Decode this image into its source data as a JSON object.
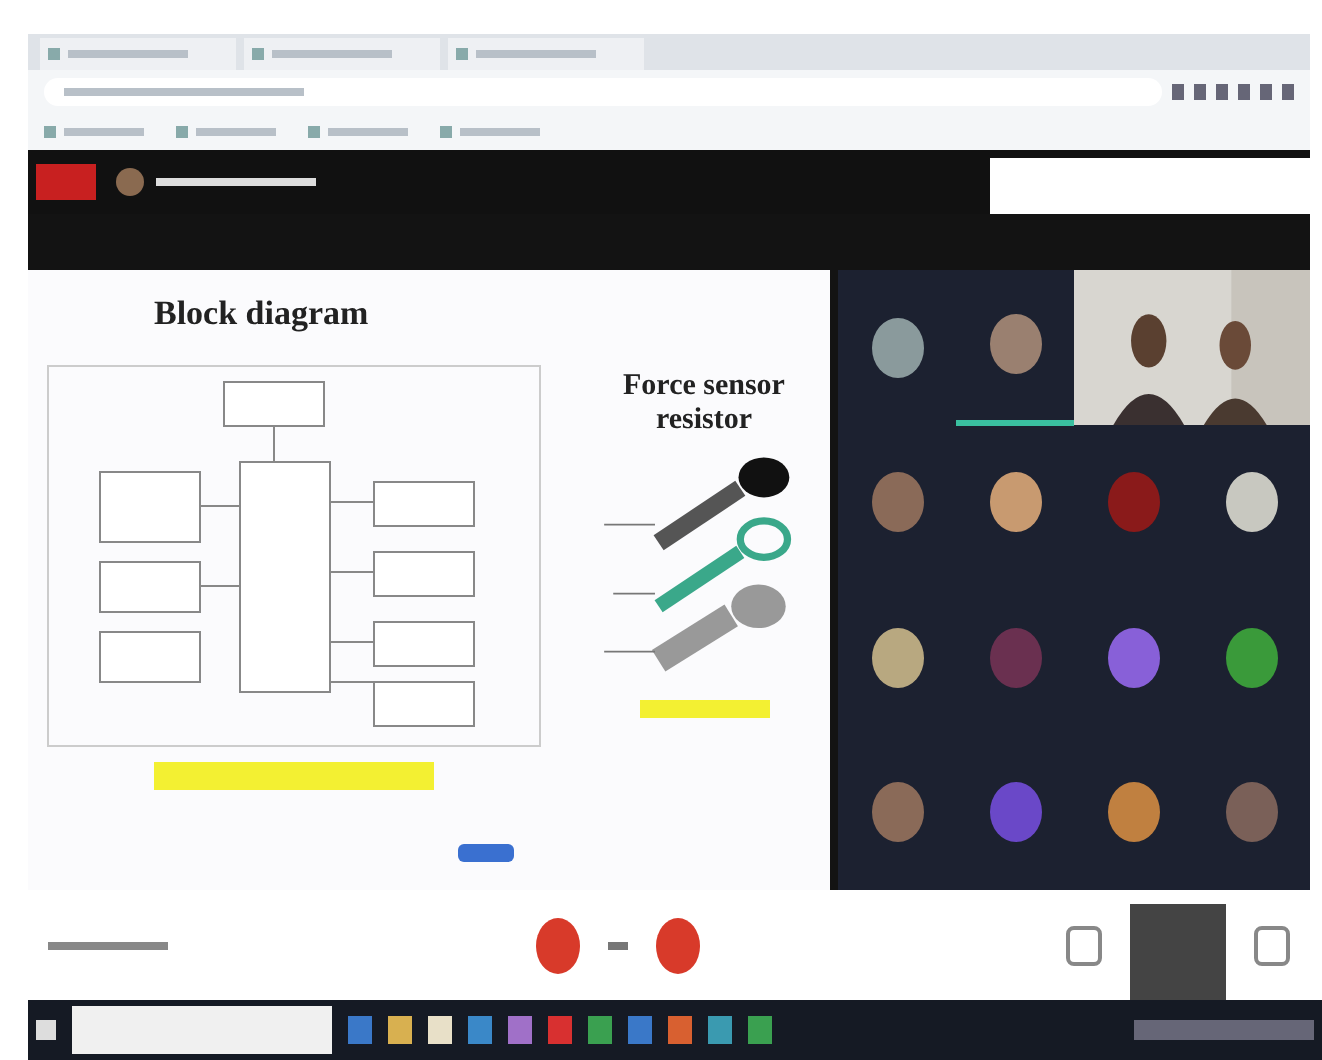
{
  "slide": {
    "title": "Block diagram",
    "side_title": "Force sensor resistor"
  },
  "participants": [
    {
      "kind": "avatar",
      "color": "#8a9a9c"
    },
    {
      "kind": "avatar",
      "color": "#9a8070",
      "speaking": true
    },
    {
      "kind": "video"
    },
    {
      "kind": "avatar",
      "color": "#8a6a58"
    },
    {
      "kind": "avatar",
      "color": "#c89a70"
    },
    {
      "kind": "avatar",
      "color": "#8a1a1a"
    },
    {
      "kind": "avatar",
      "color": "#c8c8c0"
    },
    {
      "kind": "avatar",
      "color": "#b8a880"
    },
    {
      "kind": "avatar",
      "color": "#6a3050"
    },
    {
      "kind": "avatar",
      "color": "#8860d8"
    },
    {
      "kind": "avatar",
      "color": "#3a9a3a"
    },
    {
      "kind": "avatar",
      "color": "#8a6a58"
    },
    {
      "kind": "avatar",
      "color": "#6a48c8"
    },
    {
      "kind": "avatar",
      "color": "#c08040"
    },
    {
      "kind": "avatar",
      "color": "#7a6058"
    }
  ]
}
